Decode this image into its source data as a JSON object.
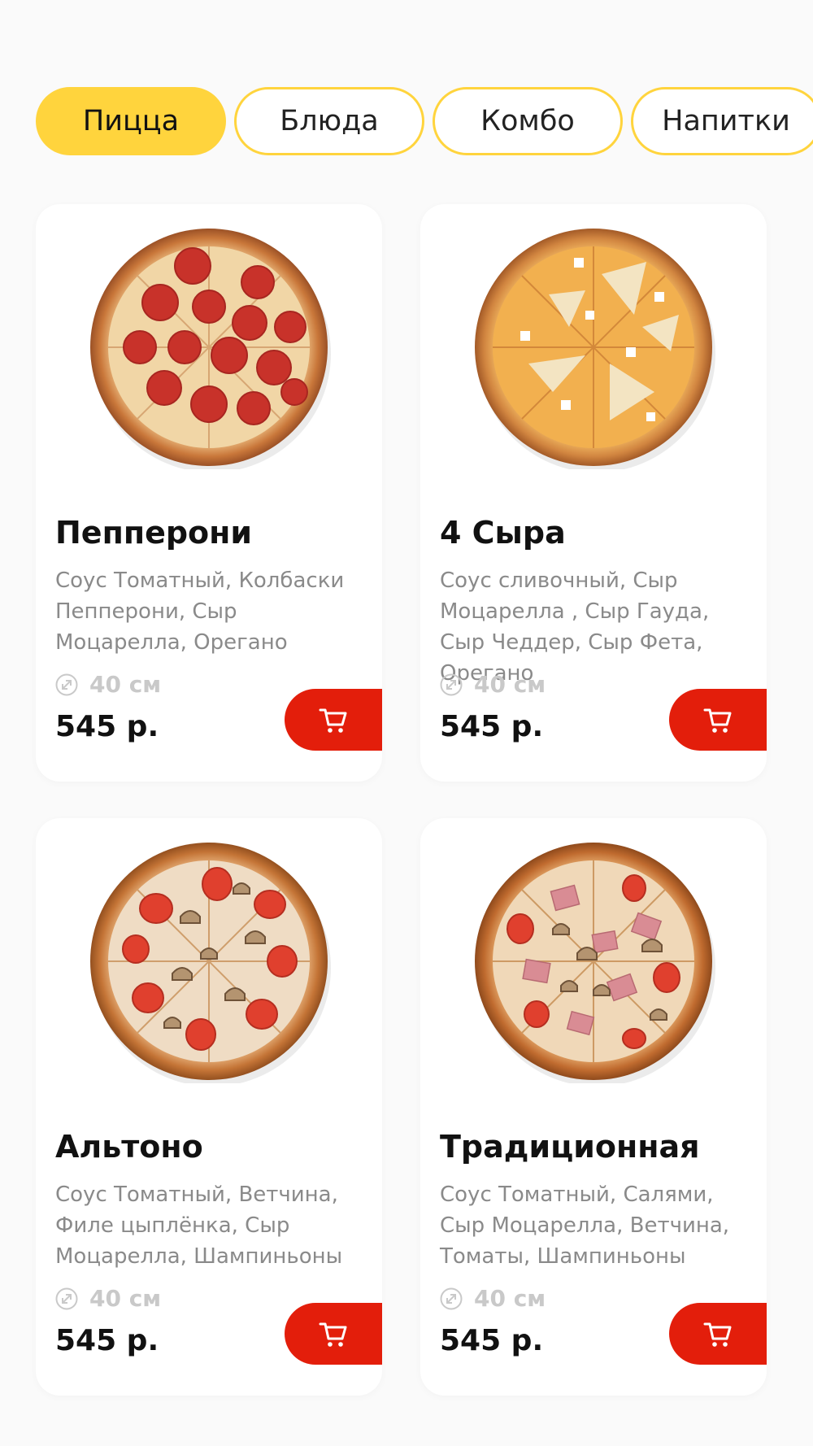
{
  "tabs": [
    {
      "label": "Пицца",
      "active": true
    },
    {
      "label": "Блюда",
      "active": false
    },
    {
      "label": "Комбо",
      "active": false
    },
    {
      "label": "Напитки",
      "active": false
    }
  ],
  "products": [
    {
      "name": "Пепперони",
      "description": "Соус Томатный, Колбаски Пепперони, Сыр Моцарелла, Орегано",
      "size": "40 см",
      "price": "545 р.",
      "image_icon": "pepperoni-pizza-image"
    },
    {
      "name": "4 Сыра",
      "description": "Соус сливочный, Сыр Моцарелла , Сыр Гауда, Сыр Чеддер, Сыр Фета, Орегано",
      "size": "40 см",
      "price": "545 р.",
      "image_icon": "four-cheese-pizza-image"
    },
    {
      "name": "Альтоно",
      "description": "Соус Томатный, Ветчина, Филе цыплёнка, Сыр Моцарелла, Шампиньоны",
      "size": "40 см",
      "price": "545 р.",
      "image_icon": "altono-pizza-image"
    },
    {
      "name": "Традиционная",
      "description": "Соус Томатный, Салями, Сыр Моцарелла, Ветчина, Томаты, Шампиньоны",
      "size": "40 см",
      "price": "545 р.",
      "image_icon": "traditional-pizza-image"
    }
  ],
  "icons": {
    "size": "resize-icon",
    "cart": "cart-icon"
  },
  "colors": {
    "accent_yellow": "#ffd43d",
    "cart_red": "#e31e0b",
    "crust": "#c9773a",
    "cheese": "#f3d9a6"
  }
}
